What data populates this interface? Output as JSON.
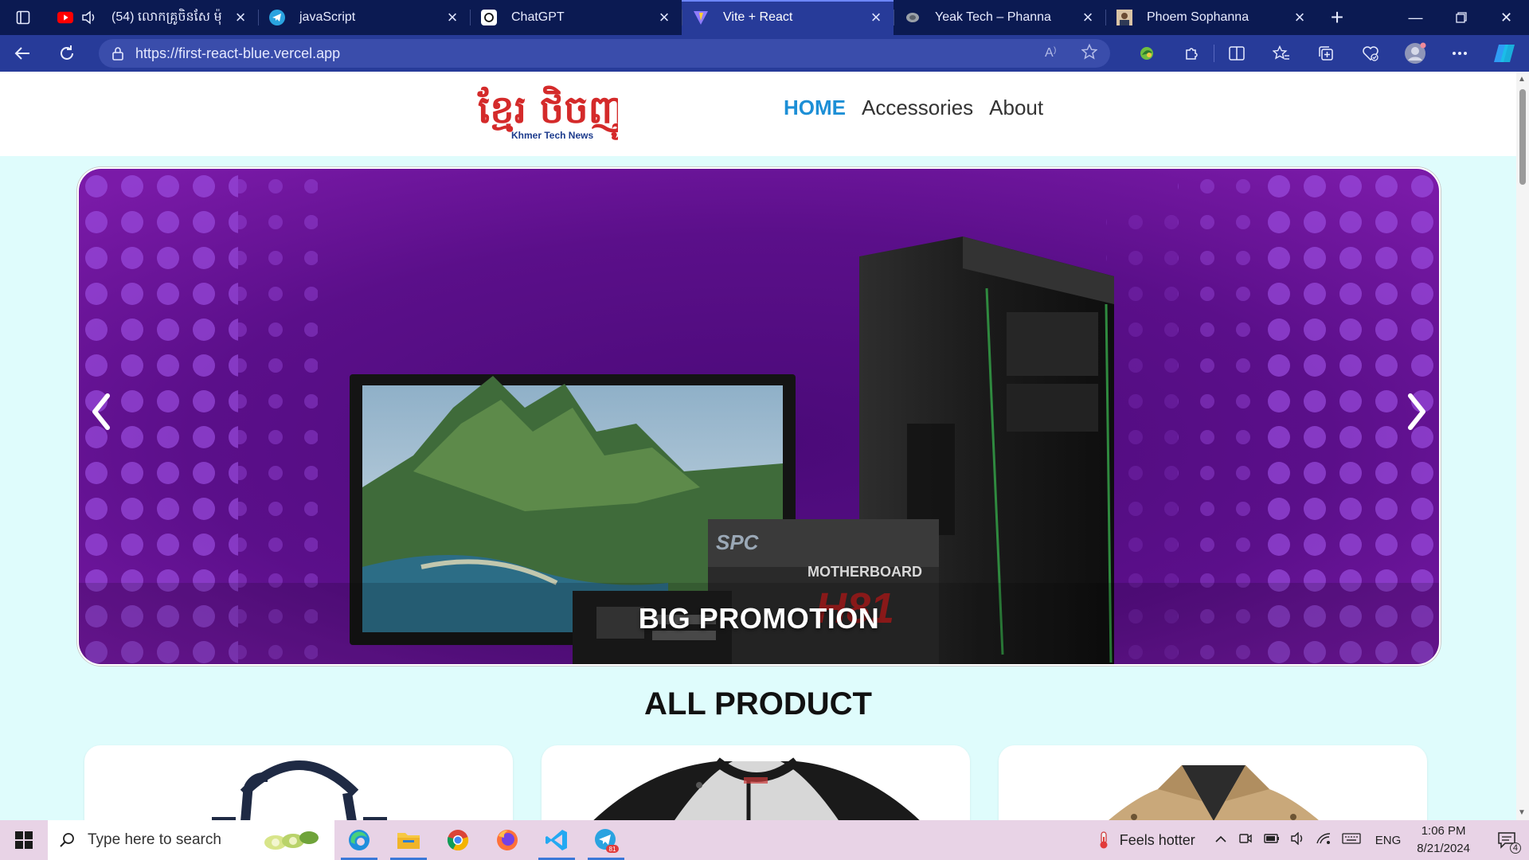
{
  "browser": {
    "tabs": [
      {
        "title": "(54) លោកគ្រូចិនសែ ម៉ុ",
        "icon": "youtube-icon",
        "active": false
      },
      {
        "title": "javaScript",
        "icon": "telegram-icon",
        "active": false
      },
      {
        "title": "ChatGPT",
        "icon": "chatgpt-icon",
        "active": false
      },
      {
        "title": "Vite + React",
        "icon": "vite-icon",
        "active": true
      },
      {
        "title": "Yeak Tech – Phanna",
        "icon": "globe-icon",
        "active": false
      },
      {
        "title": "Phoem Sophanna",
        "icon": "avatar-icon",
        "active": false
      }
    ],
    "url": "https://first-react-blue.vercel.app"
  },
  "site": {
    "logo_text_khmer": "ខ្មែរ ថិចញូ",
    "logo_text_english": "Khmer Tech News",
    "nav": [
      {
        "label": "HOME",
        "active": true
      },
      {
        "label": "Accessories",
        "active": false
      },
      {
        "label": "About",
        "active": false
      }
    ],
    "hero": {
      "caption": "BIG PROMOTION",
      "spc_text": "SPC",
      "board_text": "MOTHERBOARD",
      "board_model": "H81"
    },
    "section_title": "ALL PRODUCT",
    "products": [
      {
        "image": "tote-bag"
      },
      {
        "image": "raglan-tshirt"
      },
      {
        "image": "khaki-jacket"
      }
    ]
  },
  "taskbar": {
    "search_placeholder": "Type here to search",
    "apps": [
      "edge-icon",
      "file-explorer-icon",
      "chrome-icon",
      "firefox-icon",
      "vscode-icon",
      "telegram-icon"
    ],
    "telegram_badge": "81",
    "weather_text": "Feels hotter",
    "language": "ENG",
    "time": "1:06 PM",
    "date": "8/21/2024",
    "notification_count": "4"
  },
  "colors": {
    "tab_bar": "#0b1a52",
    "active_tab": "#273b99",
    "page_bg": "#dffcfc",
    "nav_active": "#1d8fd6",
    "hero_purple": "#5b0f8a",
    "taskbar": "#e8d3e6"
  }
}
